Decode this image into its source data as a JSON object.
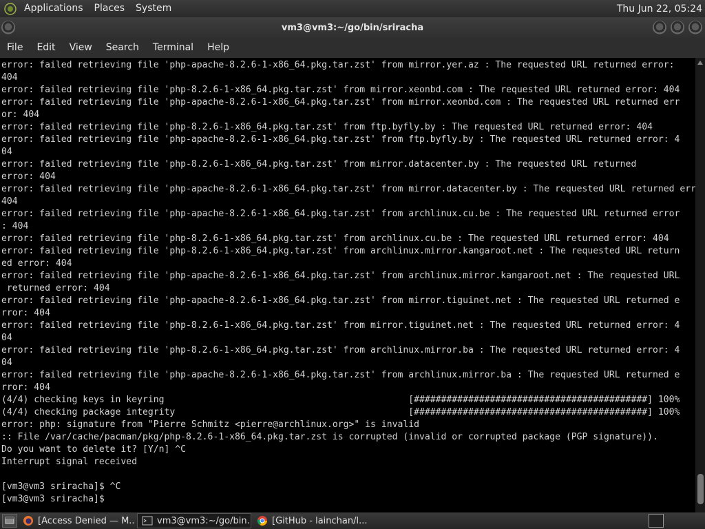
{
  "top_panel": {
    "menus": [
      "Applications",
      "Places",
      "System"
    ],
    "clock": "Thu Jun 22, 05:24"
  },
  "window": {
    "title": "vm3@vm3:~/go/bin/sriracha"
  },
  "menubar": [
    "File",
    "Edit",
    "View",
    "Search",
    "Terminal",
    "Help"
  ],
  "terminal": {
    "lines": [
      "error: failed retrieving file 'php-apache-8.2.6-1-x86_64.pkg.tar.zst' from mirror.yer.az : The requested URL returned error:",
      "404",
      "error: failed retrieving file 'php-8.2.6-1-x86_64.pkg.tar.zst' from mirror.xeonbd.com : The requested URL returned error: 404",
      "error: failed retrieving file 'php-apache-8.2.6-1-x86_64.pkg.tar.zst' from mirror.xeonbd.com : The requested URL returned err",
      "or: 404",
      "error: failed retrieving file 'php-8.2.6-1-x86_64.pkg.tar.zst' from ftp.byfly.by : The requested URL returned error: 404",
      "error: failed retrieving file 'php-apache-8.2.6-1-x86_64.pkg.tar.zst' from ftp.byfly.by : The requested URL returned error: 4",
      "04",
      "error: failed retrieving file 'php-8.2.6-1-x86_64.pkg.tar.zst' from mirror.datacenter.by : The requested URL returned",
      "error: 404",
      "error: failed retrieving file 'php-apache-8.2.6-1-x86_64.pkg.tar.zst' from mirror.datacenter.by : The requested URL returned error:",
      "404",
      "error: failed retrieving file 'php-apache-8.2.6-1-x86_64.pkg.tar.zst' from archlinux.cu.be : The requested URL returned error",
      ": 404",
      "error: failed retrieving file 'php-8.2.6-1-x86_64.pkg.tar.zst' from archlinux.cu.be : The requested URL returned error: 404",
      "error: failed retrieving file 'php-8.2.6-1-x86_64.pkg.tar.zst' from archlinux.mirror.kangaroot.net : The requested URL return",
      "ed error: 404",
      "error: failed retrieving file 'php-apache-8.2.6-1-x86_64.pkg.tar.zst' from archlinux.mirror.kangaroot.net : The requested URL",
      " returned error: 404",
      "error: failed retrieving file 'php-apache-8.2.6-1-x86_64.pkg.tar.zst' from mirror.tiguinet.net : The requested URL returned e",
      "rror: 404",
      "error: failed retrieving file 'php-8.2.6-1-x86_64.pkg.tar.zst' from mirror.tiguinet.net : The requested URL returned error: 4",
      "04",
      "error: failed retrieving file 'php-8.2.6-1-x86_64.pkg.tar.zst' from archlinux.mirror.ba : The requested URL returned error: 4",
      "04",
      "error: failed retrieving file 'php-apache-8.2.6-1-x86_64.pkg.tar.zst' from archlinux.mirror.ba : The requested URL returned e",
      "rror: 404",
      "(4/4) checking keys in keyring                                             [###########################################] 100%",
      "(4/4) checking package integrity                                           [###########################################] 100%",
      "error: php: signature from \"Pierre Schmitz <pierre@archlinux.org>\" is invalid",
      ":: File /var/cache/pacman/pkg/php-8.2.6-1-x86_64.pkg.tar.zst is corrupted (invalid or corrupted package (PGP signature)).",
      "Do you want to delete it? [Y/n] ^C",
      "Interrupt signal received",
      "",
      "[vm3@vm3 sriracha]$ ^C",
      "[vm3@vm3 sriracha]$ "
    ]
  },
  "taskbar": {
    "tasks": [
      {
        "label": "[Access Denied — M...",
        "icon": "firefox-icon"
      },
      {
        "label": "vm3@vm3:~/go/bin...",
        "icon": "terminal-icon"
      },
      {
        "label": "[GitHub - lainchan/l...",
        "icon": "chrome-icon"
      }
    ]
  },
  "colors": {
    "terminal_bg": "#000000",
    "terminal_fg": "#d3d3d3",
    "panel_bg": "#2e2e2e"
  }
}
